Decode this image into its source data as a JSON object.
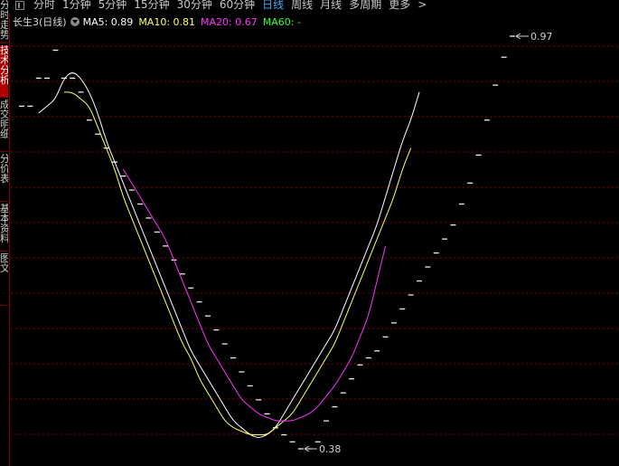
{
  "toolbar": {
    "tabs": [
      "分时",
      "1分钟",
      "5分钟",
      "15分钟",
      "30分钟",
      "60分钟",
      "日线",
      "周线",
      "月线",
      "多周期",
      "更多"
    ],
    "active_tab": "日线",
    "more_arrow": ">"
  },
  "sidebar": {
    "tabs": [
      {
        "label": "分时走势",
        "active": false
      },
      {
        "label": "技术分析",
        "active": true
      },
      {
        "label": "成交明细",
        "active": false
      },
      {
        "label": "分价表",
        "active": false
      },
      {
        "label": "基本资料",
        "active": false
      },
      {
        "label": "图文",
        "active": false
      }
    ]
  },
  "legend": {
    "title": "长生3(日线)",
    "ma5": {
      "label": "MA5: 0.89",
      "color": "#ffffff"
    },
    "ma10": {
      "label": "MA10: 0.81",
      "color": "#ffff66"
    },
    "ma20": {
      "label": "MA20: 0.67",
      "color": "#ff33ff"
    },
    "ma60": {
      "label": "MA60: -",
      "color": "#33ff33"
    }
  },
  "colors": {
    "grid": "#8b0000",
    "candle": "#ffffff",
    "ma5": "#ffffff",
    "ma10": "#ffff66",
    "ma20": "#ff33ff"
  },
  "chart_data": {
    "type": "line",
    "title": "长生3(日线)",
    "ylim": [
      0.33,
      1.02
    ],
    "annotations": [
      {
        "label": "0.97",
        "value": 0.97,
        "kind": "high"
      },
      {
        "label": "0.38",
        "value": 0.38,
        "kind": "low"
      }
    ],
    "candles": [
      0.87,
      0.87,
      0.91,
      0.91,
      0.95,
      0.91,
      0.91,
      0.89,
      0.85,
      0.83,
      0.81,
      0.79,
      0.77,
      0.75,
      0.73,
      0.71,
      0.69,
      0.67,
      0.65,
      0.63,
      0.61,
      0.59,
      0.57,
      0.55,
      0.53,
      0.51,
      0.49,
      0.47,
      0.45,
      0.43,
      0.41,
      0.4,
      0.39,
      0.38,
      0.38,
      0.39,
      0.42,
      0.44,
      0.46,
      0.48,
      0.5,
      0.51,
      0.52,
      0.54,
      0.56,
      0.58,
      0.6,
      0.62,
      0.64,
      0.66,
      0.68,
      0.7,
      0.73,
      0.76,
      0.8,
      0.85,
      0.9,
      0.94,
      0.97
    ],
    "series": [
      {
        "name": "MA5",
        "color": "#ffffff",
        "start": 2,
        "values": [
          0.86,
          0.87,
          0.88,
          0.91,
          0.92,
          0.91,
          0.89,
          0.86,
          0.82,
          0.79,
          0.76,
          0.73,
          0.7,
          0.67,
          0.64,
          0.61,
          0.58,
          0.55,
          0.52,
          0.5,
          0.48,
          0.46,
          0.44,
          0.42,
          0.41,
          0.4,
          0.395,
          0.4,
          0.41,
          0.43,
          0.45,
          0.47,
          0.49,
          0.51,
          0.53,
          0.55,
          0.58,
          0.61,
          0.64,
          0.67,
          0.7,
          0.74,
          0.78,
          0.82,
          0.85,
          0.89
        ]
      },
      {
        "name": "MA10",
        "color": "#ffff66",
        "start": 5,
        "values": [
          0.89,
          0.89,
          0.88,
          0.87,
          0.84,
          0.81,
          0.78,
          0.74,
          0.71,
          0.68,
          0.65,
          0.62,
          0.59,
          0.56,
          0.53,
          0.51,
          0.48,
          0.46,
          0.44,
          0.42,
          0.41,
          0.405,
          0.4,
          0.4,
          0.4,
          0.41,
          0.42,
          0.43,
          0.45,
          0.47,
          0.49,
          0.51,
          0.53,
          0.56,
          0.59,
          0.62,
          0.65,
          0.68,
          0.71,
          0.74,
          0.78,
          0.81
        ]
      },
      {
        "name": "MA20",
        "color": "#ff33ff",
        "start": 12,
        "values": [
          0.78,
          0.76,
          0.74,
          0.72,
          0.7,
          0.68,
          0.65,
          0.62,
          0.59,
          0.56,
          0.53,
          0.51,
          0.49,
          0.47,
          0.45,
          0.44,
          0.43,
          0.425,
          0.42,
          0.42,
          0.42,
          0.425,
          0.43,
          0.44,
          0.455,
          0.47,
          0.49,
          0.51,
          0.54,
          0.57,
          0.62,
          0.67
        ]
      }
    ]
  }
}
